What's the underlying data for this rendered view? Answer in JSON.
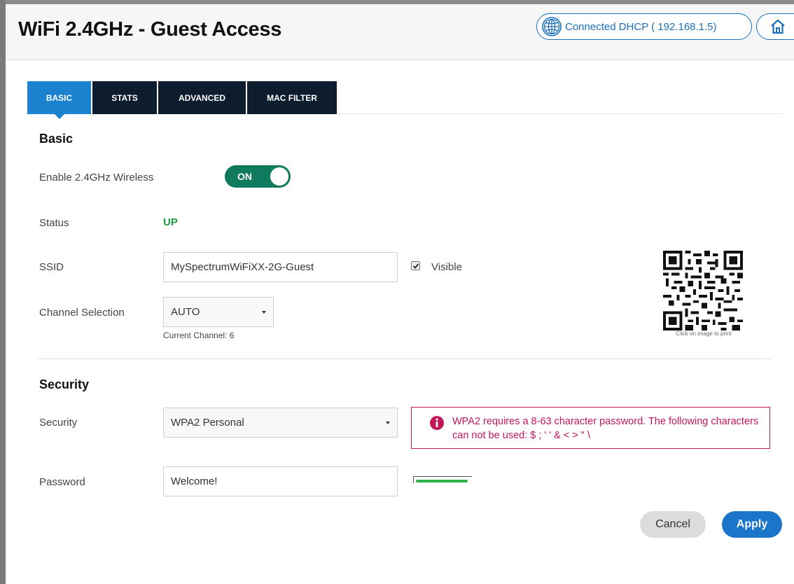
{
  "header": {
    "title": "WiFi 2.4GHz - Guest Access",
    "connection_label": "Connected DHCP ( 192.168.1.5)",
    "connection_icon": "globe-icon",
    "home_icon": "home-icon",
    "accent_color": "#1b6fba"
  },
  "tabs": [
    {
      "label": "BASIC",
      "active": true
    },
    {
      "label": "STATS",
      "active": false
    },
    {
      "label": "ADVANCED",
      "active": false
    },
    {
      "label": "MAC FILTER",
      "active": false
    }
  ],
  "basic": {
    "section_title": "Basic",
    "enable_label": "Enable 2.4GHz Wireless",
    "enable_toggle": "ON",
    "enabled": true,
    "status_label": "Status",
    "status_value": "UP",
    "status_color": "#1c9a3e",
    "ssid_label": "SSID",
    "ssid_value": "MySpectrumWiFiXX-2G-Guest",
    "visible_label": "Visible",
    "visible_checked": true,
    "channel_label": "Channel Selection",
    "channel_value": "AUTO",
    "current_channel": "Current Channel: 6",
    "qr_caption": "Click on image to print"
  },
  "security": {
    "section_title": "Security",
    "security_label": "Security",
    "security_value": "WPA2 Personal",
    "error_message": "WPA2 requires a 8-63 character password. The following characters can not be used: $ ; ' ' & < > \" \\",
    "error_color": "#c2185b",
    "password_label": "Password",
    "password_value": "Welcome!",
    "password_strength": 0.95,
    "strength_color": "#2db34a"
  },
  "actions": {
    "cancel_label": "Cancel",
    "apply_label": "Apply"
  }
}
